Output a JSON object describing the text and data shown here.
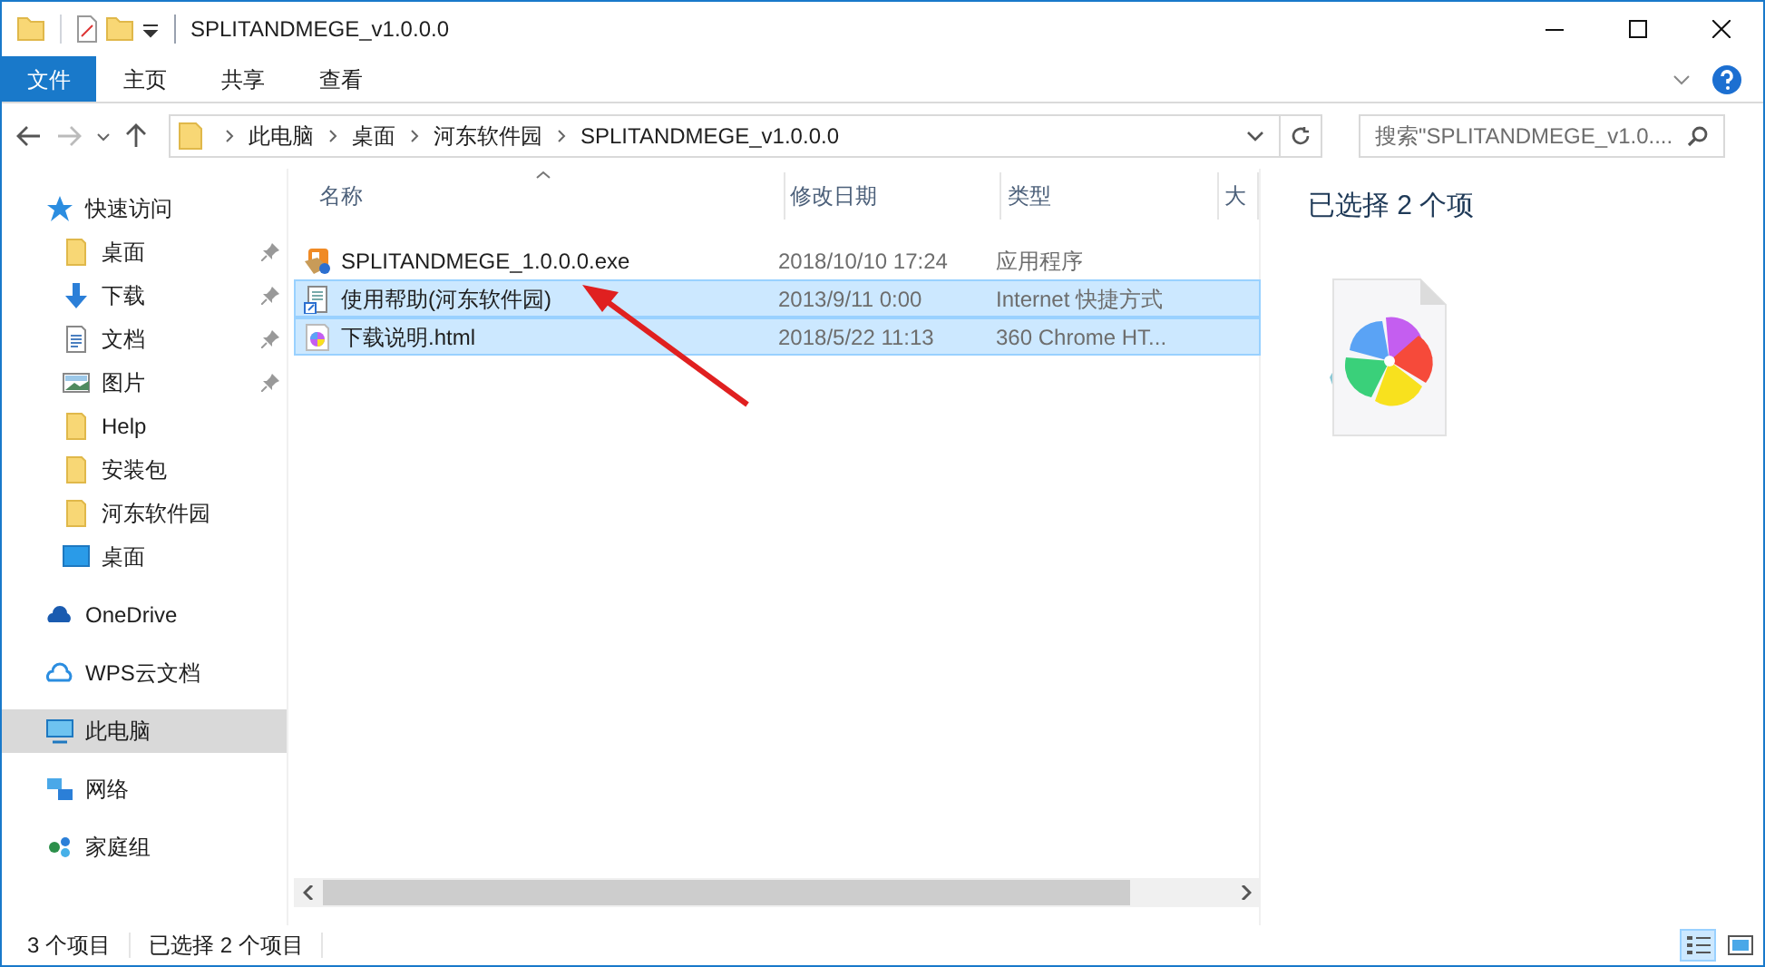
{
  "window": {
    "title": "SPLITANDMEGE_v1.0.0.0"
  },
  "ribbon_tabs": [
    {
      "label": "文件",
      "kind": "file",
      "selected": false
    },
    {
      "label": "主页",
      "kind": "tab",
      "selected": false
    },
    {
      "label": "共享",
      "kind": "tab",
      "selected": false
    },
    {
      "label": "查看",
      "kind": "tab",
      "selected": false
    }
  ],
  "address_bar": {
    "crumbs": [
      "此电脑",
      "桌面",
      "河东软件园",
      "SPLITANDMEGE_v1.0.0.0"
    ]
  },
  "search": {
    "placeholder": "搜索\"SPLITANDMEGE_v1.0...."
  },
  "sidebar": {
    "items": [
      {
        "label": "快速访问",
        "kind": "star",
        "selected": false,
        "children": [
          {
            "label": "桌面",
            "kind": "folder",
            "pinned": true,
            "selected": false
          },
          {
            "label": "下载",
            "kind": "download",
            "pinned": true,
            "selected": false
          },
          {
            "label": "文档",
            "kind": "document",
            "pinned": true,
            "selected": false
          },
          {
            "label": "图片",
            "kind": "image",
            "pinned": true,
            "selected": false
          },
          {
            "label": "Help",
            "kind": "folder",
            "pinned": false,
            "selected": false
          },
          {
            "label": "安装包",
            "kind": "folder",
            "pinned": false,
            "selected": false
          },
          {
            "label": "河东软件园",
            "kind": "folder",
            "pinned": false,
            "selected": false
          },
          {
            "label": "桌面",
            "kind": "desktop",
            "pinned": false,
            "selected": false
          }
        ]
      },
      {
        "label": "OneDrive",
        "kind": "cloud",
        "selected": false
      },
      {
        "label": "WPS云文档",
        "kind": "cloud-outline",
        "selected": false
      },
      {
        "label": "此电脑",
        "kind": "computer",
        "selected": true
      },
      {
        "label": "网络",
        "kind": "network",
        "selected": false
      },
      {
        "label": "家庭组",
        "kind": "homegroup",
        "selected": false
      }
    ]
  },
  "table": {
    "columns": [
      "名称",
      "修改日期",
      "类型",
      "大"
    ],
    "rows": [
      {
        "name": "SPLITANDMEGE_1.0.0.0.exe",
        "modified": "2018/10/10 17:24",
        "type": "应用程序",
        "kind": "exe",
        "selected": false
      },
      {
        "name": "使用帮助(河东软件园)",
        "modified": "2013/9/11 0:00",
        "type": "Internet 快捷方式",
        "kind": "shortcut",
        "selected": true
      },
      {
        "name": "下载说明.html",
        "modified": "2018/5/22 11:13",
        "type": "360 Chrome HT...",
        "kind": "html",
        "selected": true
      }
    ]
  },
  "details_pane": {
    "heading": "已选择 2 个项"
  },
  "status_bar": {
    "item_count": "3 个项目",
    "selection": "已选择 2 个项目"
  },
  "view_buttons": [
    {
      "kind": "details",
      "selected": true
    },
    {
      "kind": "large-icons",
      "selected": false
    }
  ]
}
